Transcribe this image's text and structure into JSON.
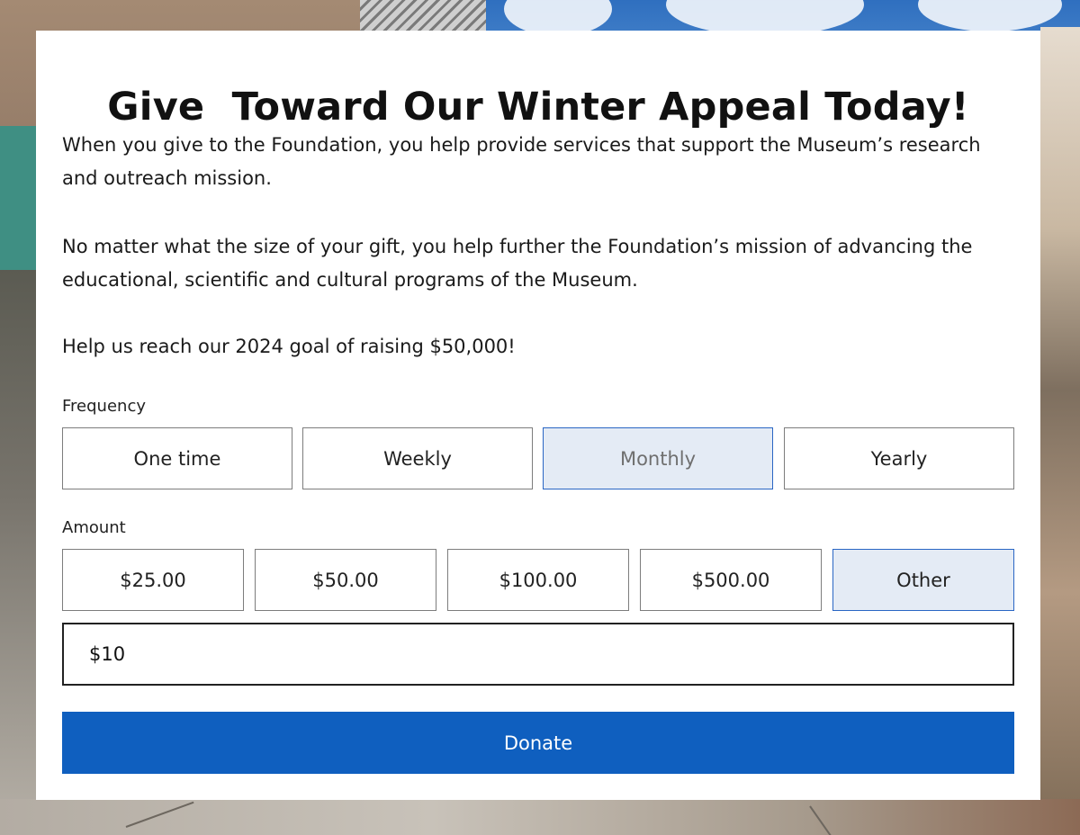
{
  "page": {
    "title": "Give  Toward Our Winter Appeal Today!",
    "paragraphs": [
      "When you give to the Foundation, you help provide services that support the Museum’s research and outreach mission.",
      "No matter what the size of your gift, you help further the Foundation’s mission of advancing the educational, scientific and cultural programs of the Museum.",
      "Help us reach our 2024 goal of raising $50,000!"
    ]
  },
  "frequency": {
    "label": "Frequency",
    "options": [
      "One time",
      "Weekly",
      "Monthly",
      "Yearly"
    ],
    "selected": "Monthly"
  },
  "amount": {
    "label": "Amount",
    "options": [
      "$25.00",
      "$50.00",
      "$100.00",
      "$500.00",
      "Other"
    ],
    "selected": "Other",
    "custom_value": "$10"
  },
  "donate": {
    "label": "Donate"
  },
  "colors": {
    "accent": "#0f5fbf",
    "selected_bg": "#e4ebf5",
    "selected_border": "#2a66c4"
  }
}
